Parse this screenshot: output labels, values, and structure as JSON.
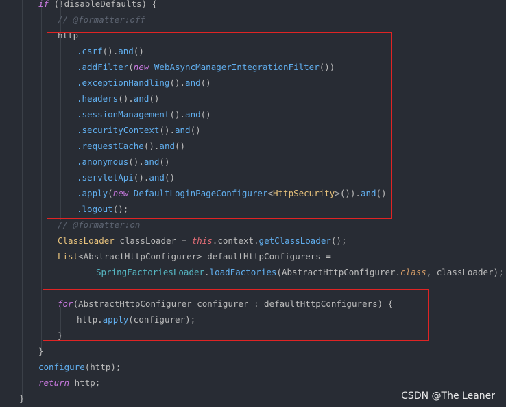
{
  "code_lines": [
    {
      "segs": [
        [
          "kw",
          "if"
        ],
        [
          "pl",
          " (!disableDefaults) {"
        ]
      ]
    },
    {
      "segs": [
        [
          "cm",
          "// @formatter:off"
        ]
      ]
    },
    {
      "segs": [
        [
          "pl",
          "http"
        ]
      ]
    },
    {
      "segs": [
        [
          "fn",
          ".csrf"
        ],
        [
          "pl",
          "()."
        ],
        [
          "fn",
          "and"
        ],
        [
          "pl",
          "()"
        ]
      ]
    },
    {
      "segs": [
        [
          "fn",
          ".addFilter"
        ],
        [
          "pl",
          "("
        ],
        [
          "new",
          "new "
        ],
        [
          "fn",
          "WebAsyncManagerIntegrationFilter"
        ],
        [
          "pl",
          "())"
        ]
      ]
    },
    {
      "segs": [
        [
          "fn",
          ".exceptionHandling"
        ],
        [
          "pl",
          "()."
        ],
        [
          "fn",
          "and"
        ],
        [
          "pl",
          "()"
        ]
      ]
    },
    {
      "segs": [
        [
          "fn",
          ".headers"
        ],
        [
          "pl",
          "()."
        ],
        [
          "fn",
          "and"
        ],
        [
          "pl",
          "()"
        ]
      ]
    },
    {
      "segs": [
        [
          "fn",
          ".sessionManagement"
        ],
        [
          "pl",
          "()."
        ],
        [
          "fn",
          "and"
        ],
        [
          "pl",
          "()"
        ]
      ]
    },
    {
      "segs": [
        [
          "fn",
          ".securityContext"
        ],
        [
          "pl",
          "()."
        ],
        [
          "fn",
          "and"
        ],
        [
          "pl",
          "()"
        ]
      ]
    },
    {
      "segs": [
        [
          "fn",
          ".requestCache"
        ],
        [
          "pl",
          "()."
        ],
        [
          "fn",
          "and"
        ],
        [
          "pl",
          "()"
        ]
      ]
    },
    {
      "segs": [
        [
          "fn",
          ".anonymous"
        ],
        [
          "pl",
          "()."
        ],
        [
          "fn",
          "and"
        ],
        [
          "pl",
          "()"
        ]
      ]
    },
    {
      "segs": [
        [
          "fn",
          ".servletApi"
        ],
        [
          "pl",
          "()."
        ],
        [
          "fn",
          "and"
        ],
        [
          "pl",
          "()"
        ]
      ]
    },
    {
      "segs": [
        [
          "fn",
          ".apply"
        ],
        [
          "pl",
          "("
        ],
        [
          "new",
          "new "
        ],
        [
          "fn",
          "DefaultLoginPageConfigurer"
        ],
        [
          "pl",
          "<"
        ],
        [
          "ty2",
          "HttpSecurity"
        ],
        [
          "pl",
          ">())."
        ],
        [
          "fn",
          "and"
        ],
        [
          "pl",
          "()"
        ]
      ]
    },
    {
      "segs": [
        [
          "fn",
          ".logout"
        ],
        [
          "pl",
          "();"
        ]
      ]
    },
    {
      "segs": [
        [
          "cm",
          "// @formatter:on"
        ]
      ]
    },
    {
      "segs": [
        [
          "ty2",
          "ClassLoader"
        ],
        [
          "pl",
          " classLoader = "
        ],
        [
          "this",
          "this"
        ],
        [
          "pl",
          "."
        ],
        [
          "pl",
          "context."
        ],
        [
          "fn",
          "getClassLoader"
        ],
        [
          "pl",
          "();"
        ]
      ]
    },
    {
      "segs": [
        [
          "ty2",
          "List"
        ],
        [
          "pl",
          "<"
        ],
        [
          "pl",
          "AbstractHttpConfigurer"
        ],
        [
          "pl",
          "> defaultHttpConfigurers ="
        ]
      ]
    },
    {
      "segs": [
        [
          "ty",
          "SpringFactoriesLoader"
        ],
        [
          "pl",
          "."
        ],
        [
          "fn",
          "loadFactories"
        ],
        [
          "pl",
          "(AbstractHttpConfigurer."
        ],
        [
          "cls",
          "class"
        ],
        [
          "pl",
          ", classLoader);"
        ]
      ]
    },
    {
      "segs": [
        [
          "pl",
          ""
        ]
      ]
    },
    {
      "segs": [
        [
          "kw",
          "for"
        ],
        [
          "pl",
          "(AbstractHttpConfigurer configurer : defaultHttpConfigurers) {"
        ]
      ]
    },
    {
      "segs": [
        [
          "pl",
          "http."
        ],
        [
          "fn",
          "apply"
        ],
        [
          "pl",
          "(configurer);"
        ]
      ]
    },
    {
      "segs": [
        [
          "pl",
          "}"
        ]
      ]
    },
    {
      "segs": [
        [
          "pl",
          "}"
        ]
      ]
    },
    {
      "segs": [
        [
          "fn",
          "configure"
        ],
        [
          "pl",
          "(http);"
        ]
      ]
    },
    {
      "segs": [
        [
          "kw",
          "return"
        ],
        [
          "pl",
          " http;"
        ]
      ]
    },
    {
      "segs": [
        [
          "pl",
          "}"
        ]
      ]
    }
  ],
  "watermark": "CSDN @The Leaner"
}
